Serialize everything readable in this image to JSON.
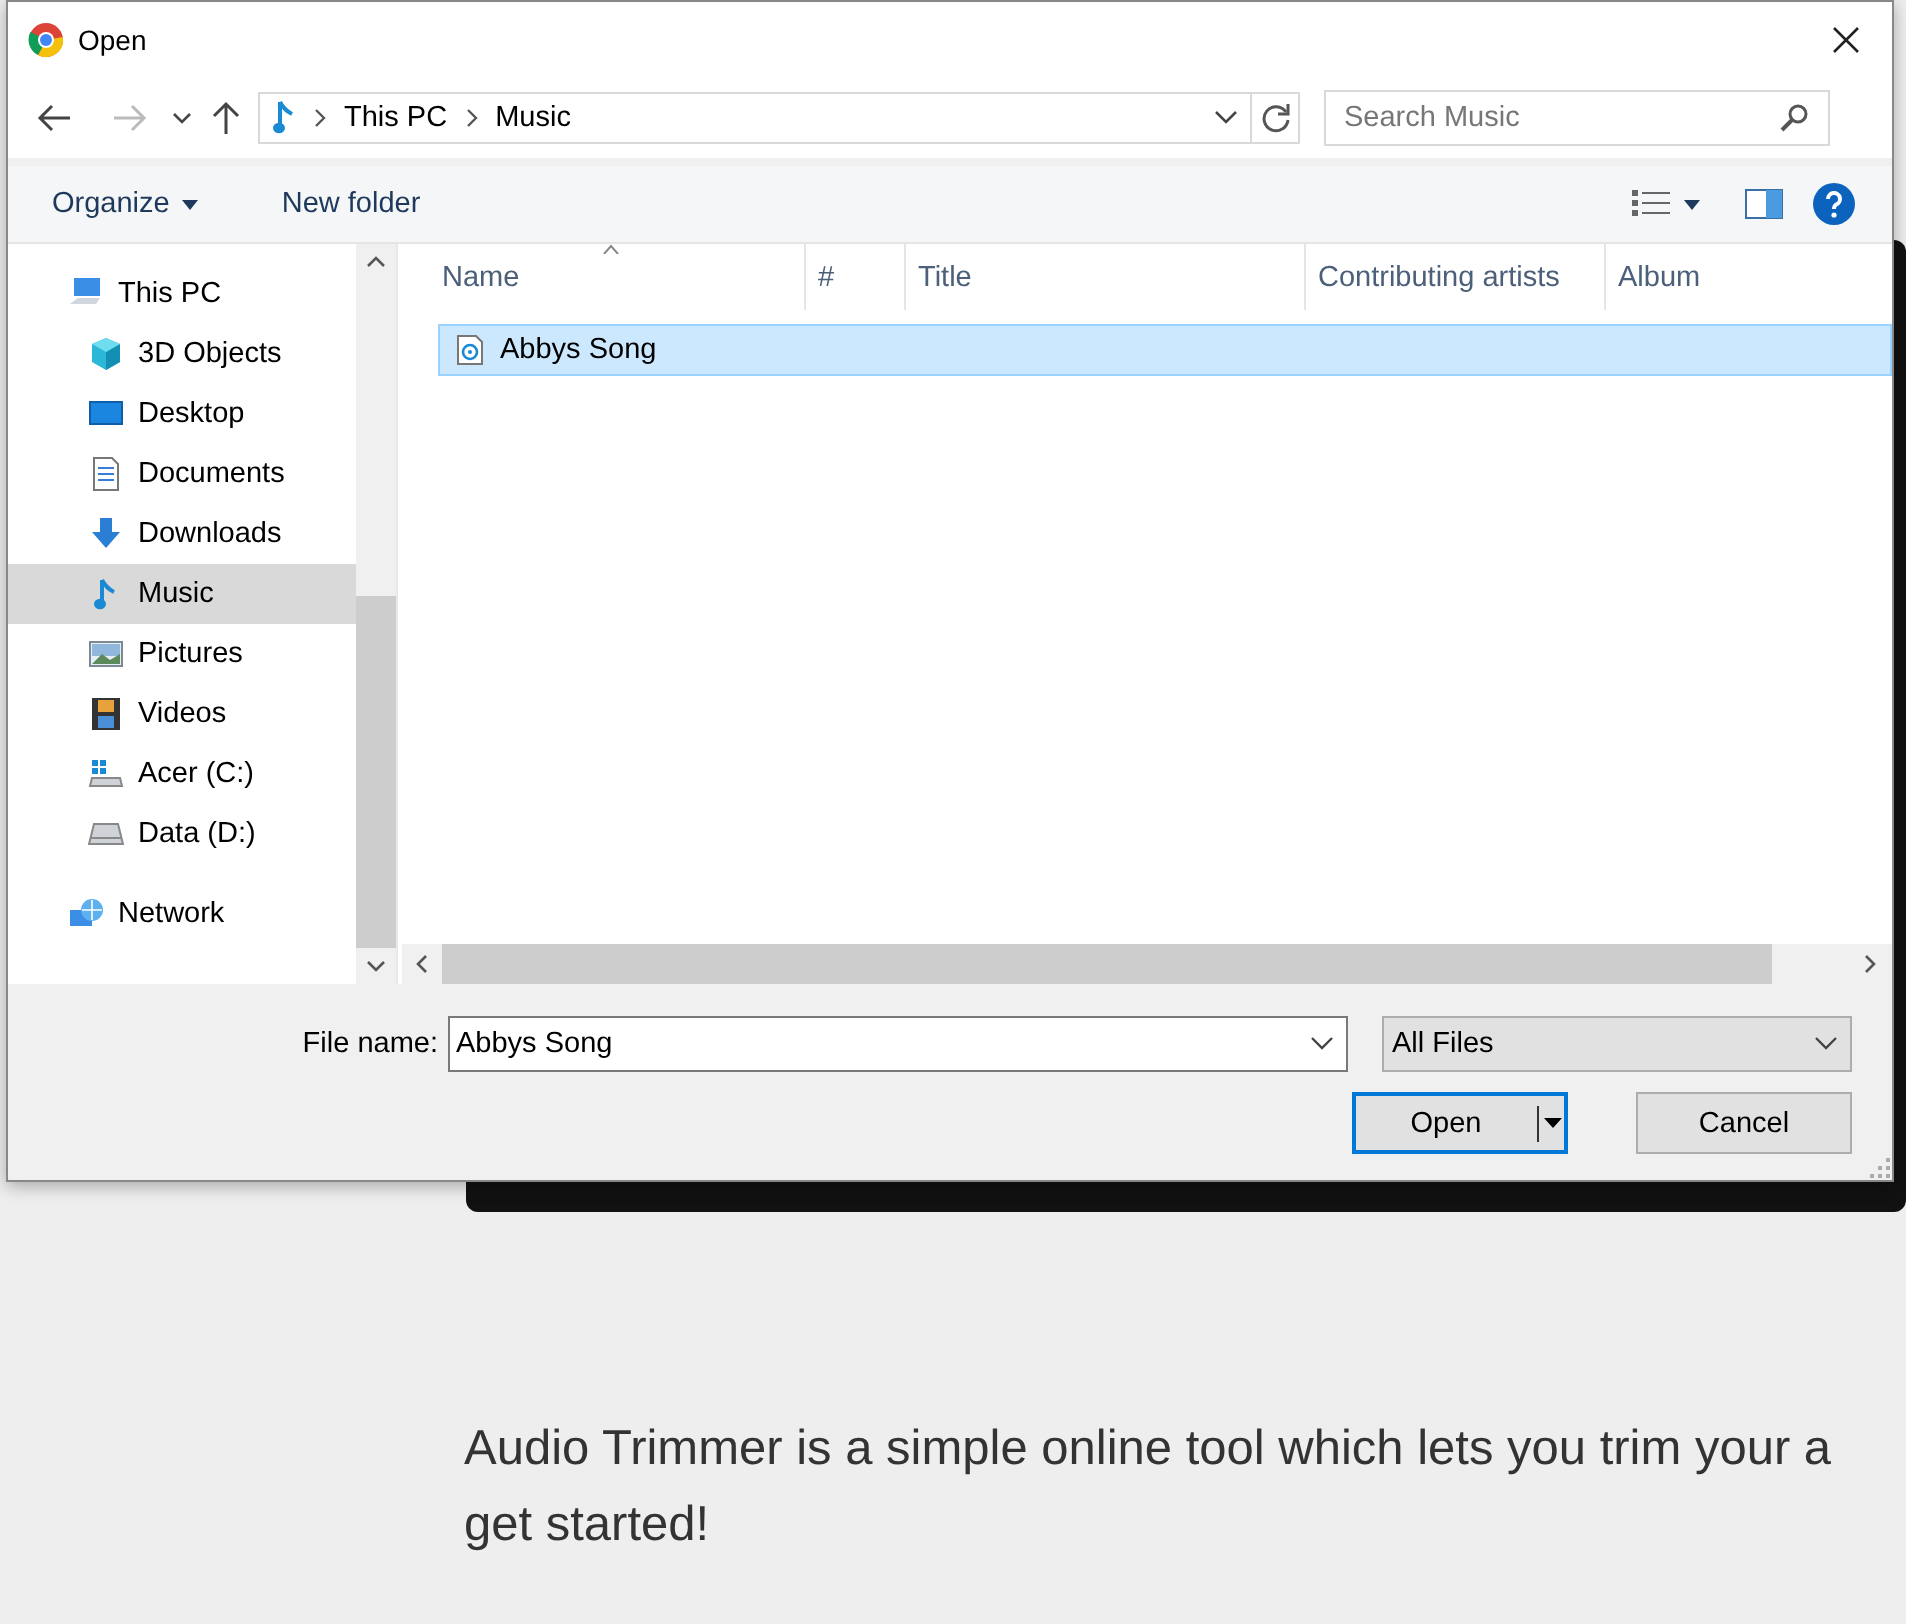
{
  "page": {
    "paragraph_lines": [
      "Audio Trimmer is a simple online tool which lets you trim your a",
      "get started!"
    ]
  },
  "dialog": {
    "title": "Open",
    "address": {
      "segments": [
        "This PC",
        "Music"
      ]
    },
    "search": {
      "placeholder": "Search Music"
    },
    "toolbar": {
      "organize": "Organize",
      "new_folder": "New folder"
    },
    "nav_pane": {
      "items": [
        {
          "label": "This PC",
          "kind": "pc",
          "selected": false,
          "children": [
            {
              "label": "3D Objects",
              "kind": "cube",
              "selected": false
            },
            {
              "label": "Desktop",
              "kind": "desktop",
              "selected": false
            },
            {
              "label": "Documents",
              "kind": "document",
              "selected": false
            },
            {
              "label": "Downloads",
              "kind": "download",
              "selected": false
            },
            {
              "label": "Music",
              "kind": "music",
              "selected": true
            },
            {
              "label": "Pictures",
              "kind": "pictures",
              "selected": false
            },
            {
              "label": "Videos",
              "kind": "videos",
              "selected": false
            },
            {
              "label": "Acer (C:)",
              "kind": "os-drive",
              "selected": false
            },
            {
              "label": "Data (D:)",
              "kind": "drive",
              "selected": false
            }
          ]
        },
        {
          "label": "Network",
          "kind": "network",
          "selected": false
        }
      ]
    },
    "file_list": {
      "columns": [
        "Name",
        "#",
        "Title",
        "Contributing artists",
        "Album"
      ],
      "rows": [
        {
          "name": "Abbys Song",
          "selected": true
        }
      ]
    },
    "file_name": {
      "label": "File name:",
      "value": "Abbys Song"
    },
    "file_type": {
      "value": "All Files"
    },
    "buttons": {
      "open": "Open",
      "cancel": "Cancel"
    }
  }
}
